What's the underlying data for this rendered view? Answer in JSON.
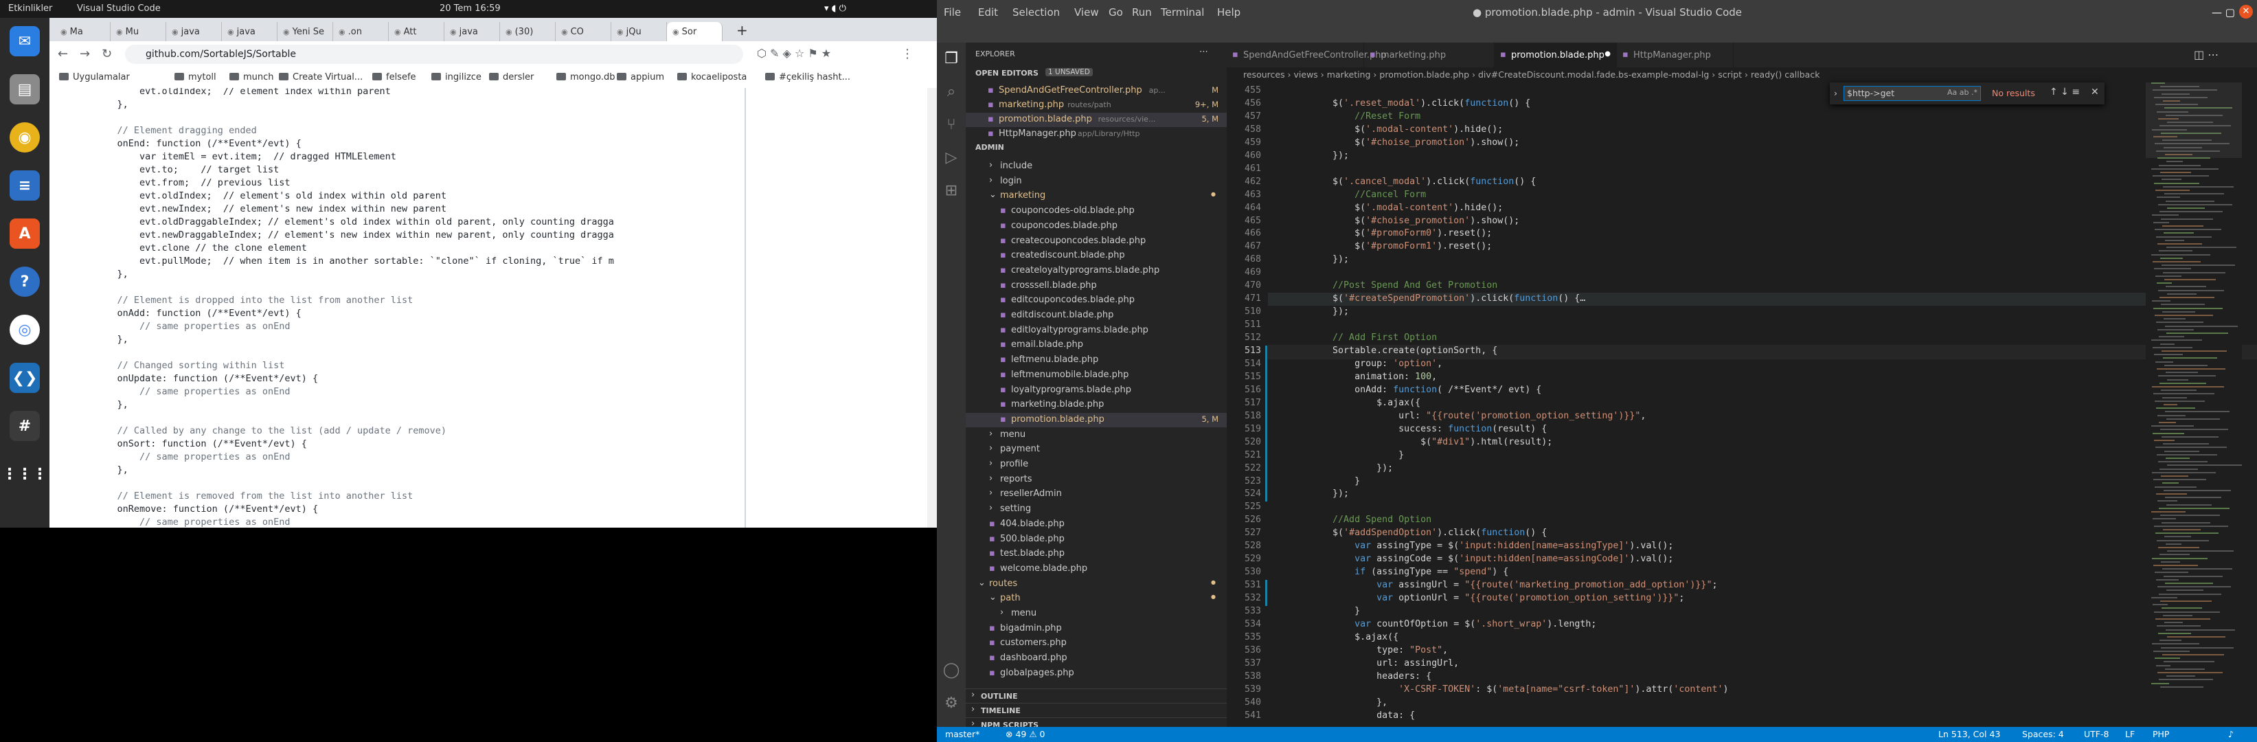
{
  "system": {
    "activities": "Etkinlikler",
    "app_menu": "Visual Studio Code",
    "clock": "20 Tem  16:59"
  },
  "browser": {
    "tabs": [
      "Ma",
      "Mu",
      "java",
      "java",
      "Yeni Se",
      ".on",
      "Att",
      "java",
      "(30)",
      "CO",
      "jQu",
      "Sor"
    ],
    "url": "github.com/SortableJS/Sortable",
    "bookmarks": [
      "Uygulamalar",
      "mytoll",
      "munch",
      "Create Virtual...",
      "felsefe",
      "ingilizce",
      "dersler",
      "mongo.db",
      "appium",
      "kocaeliposta",
      "#çekiliş hasht..."
    ],
    "code_lines": [
      "        evt.oldIndex;  // element index within parent",
      "    },",
      "",
      "    // Element dragging ended",
      "    onEnd: function (/**Event*/evt) {",
      "        var itemEl = evt.item;  // dragged HTMLElement",
      "        evt.to;    // target list",
      "        evt.from;  // previous list",
      "        evt.oldIndex;  // element's old index within old parent",
      "        evt.newIndex;  // element's new index within new parent",
      "        evt.oldDraggableIndex; // element's old index within old parent, only counting dragga",
      "        evt.newDraggableIndex; // element's new index within new parent, only counting dragga",
      "        evt.clone // the clone element",
      "        evt.pullMode;  // when item is in another sortable: `\"clone\"` if cloning, `true` if m",
      "    },",
      "",
      "    // Element is dropped into the list from another list",
      "    onAdd: function (/**Event*/evt) {",
      "        // same properties as onEnd",
      "    },",
      "",
      "    // Changed sorting within list",
      "    onUpdate: function (/**Event*/evt) {",
      "        // same properties as onEnd",
      "    },",
      "",
      "    // Called by any change to the list (add / update / remove)",
      "    onSort: function (/**Event*/evt) {",
      "        // same properties as onEnd",
      "    },",
      "",
      "    // Element is removed from the list into another list",
      "    onRemove: function (/**Event*/evt) {",
      "        // same properties as onEnd"
    ]
  },
  "vscode": {
    "title": "● promotion.blade.php - admin - Visual Studio Code",
    "menu": [
      "File",
      "Edit",
      "Selection",
      "View",
      "Go",
      "Run",
      "Terminal",
      "Help"
    ],
    "explorer_title": "EXPLORER",
    "open_editors_label": "OPEN EDITORS",
    "unsaved_badge": "1 UNSAVED",
    "open_editors": [
      {
        "name": "SpendAndGetFreeController.php",
        "path": "ap...",
        "flag": "M"
      },
      {
        "name": "marketing.php",
        "path": "routes/path",
        "flag": "9+, M"
      },
      {
        "name": "promotion.blade.php",
        "path": "resources/vie...",
        "flag": "5, M"
      },
      {
        "name": "HttpManager.php",
        "path": "app/Library/Http",
        "flag": ""
      }
    ],
    "workspace": "ADMIN",
    "tree": [
      {
        "label": "include",
        "indent": 1,
        "folder": true
      },
      {
        "label": "login",
        "indent": 1,
        "folder": true
      },
      {
        "label": "marketing",
        "indent": 1,
        "folder": true,
        "open": true,
        "mod": true
      },
      {
        "label": "couponcodes-old.blade.php",
        "indent": 2
      },
      {
        "label": "couponcodes.blade.php",
        "indent": 2
      },
      {
        "label": "createcouponcodes.blade.php",
        "indent": 2
      },
      {
        "label": "creatediscount.blade.php",
        "indent": 2
      },
      {
        "label": "createloyaltyprograms.blade.php",
        "indent": 2
      },
      {
        "label": "crosssell.blade.php",
        "indent": 2
      },
      {
        "label": "editcouponcodes.blade.php",
        "indent": 2
      },
      {
        "label": "editdiscount.blade.php",
        "indent": 2
      },
      {
        "label": "editloyaltyprograms.blade.php",
        "indent": 2
      },
      {
        "label": "email.blade.php",
        "indent": 2
      },
      {
        "label": "leftmenu.blade.php",
        "indent": 2
      },
      {
        "label": "leftmenumobile.blade.php",
        "indent": 2
      },
      {
        "label": "loyaltyprograms.blade.php",
        "indent": 2
      },
      {
        "label": "marketing.blade.php",
        "indent": 2
      },
      {
        "label": "promotion.blade.php",
        "indent": 2,
        "active": true,
        "flag": "5, M"
      },
      {
        "label": "menu",
        "indent": 1,
        "folder": true
      },
      {
        "label": "payment",
        "indent": 1,
        "folder": true
      },
      {
        "label": "profile",
        "indent": 1,
        "folder": true
      },
      {
        "label": "reports",
        "indent": 1,
        "folder": true
      },
      {
        "label": "resellerAdmin",
        "indent": 1,
        "folder": true
      },
      {
        "label": "setting",
        "indent": 1,
        "folder": true
      },
      {
        "label": "404.blade.php",
        "indent": 1
      },
      {
        "label": "500.blade.php",
        "indent": 1
      },
      {
        "label": "test.blade.php",
        "indent": 1
      },
      {
        "label": "welcome.blade.php",
        "indent": 1
      },
      {
        "label": "routes",
        "indent": 0,
        "folder": true,
        "open": true,
        "mod": true
      },
      {
        "label": "path",
        "indent": 1,
        "folder": true,
        "open": true,
        "mod": true
      },
      {
        "label": "menu",
        "indent": 2,
        "folder": true
      },
      {
        "label": "bigadmin.php",
        "indent": 1
      },
      {
        "label": "customers.php",
        "indent": 1
      },
      {
        "label": "dashboard.php",
        "indent": 1
      },
      {
        "label": "globalpages.php",
        "indent": 1
      }
    ],
    "panels": [
      "OUTLINE",
      "TIMELINE",
      "NPM SCRIPTS"
    ],
    "editor_tabs": [
      "SpendAndGetFreeController.php",
      "marketing.php",
      "promotion.blade.php",
      "HttpManager.php"
    ],
    "breadcrumbs": "resources › views › marketing › promotion.blade.php › div#CreateDiscount.modal.fade.bs-example-modal-lg › script › ready() callback",
    "find": {
      "value": "$http->get",
      "result": "No results"
    },
    "code": [
      {
        "n": "455",
        "t": ""
      },
      {
        "n": "456",
        "t": "        $('.reset_modal').click(function() {"
      },
      {
        "n": "457",
        "t": "            //Reset Form"
      },
      {
        "n": "458",
        "t": "            $('.modal-content').hide();"
      },
      {
        "n": "459",
        "t": "            $('#choise_promotion').show();"
      },
      {
        "n": "460",
        "t": "        });"
      },
      {
        "n": "461",
        "t": ""
      },
      {
        "n": "462",
        "t": "        $('.cancel_modal').click(function() {"
      },
      {
        "n": "463",
        "t": "            //Cancel Form"
      },
      {
        "n": "464",
        "t": "            $('.modal-content').hide();"
      },
      {
        "n": "465",
        "t": "            $('#choise_promotion').show();"
      },
      {
        "n": "466",
        "t": "            $('#promoForm0').reset();"
      },
      {
        "n": "467",
        "t": "            $('#promoForm1').reset();"
      },
      {
        "n": "468",
        "t": "        });"
      },
      {
        "n": "469",
        "t": ""
      },
      {
        "n": "470",
        "t": "        //Post Spend And Get Promotion"
      },
      {
        "n": "471",
        "t": "        $('#createSpendPromotion').click(function() {…"
      },
      {
        "n": "510",
        "t": "        });"
      },
      {
        "n": "511",
        "t": ""
      },
      {
        "n": "512",
        "t": "        // Add First Option"
      },
      {
        "n": "513",
        "t": "        Sortable.create(optionSorth, {"
      },
      {
        "n": "514",
        "t": "            group: 'option',"
      },
      {
        "n": "515",
        "t": "            animation: 100,"
      },
      {
        "n": "516",
        "t": "            onAdd: function( /**Event*/ evt) {"
      },
      {
        "n": "517",
        "t": "                $.ajax({"
      },
      {
        "n": "518",
        "t": "                    url: \"{{route('promotion_option_setting')}}\","
      },
      {
        "n": "519",
        "t": "                    success: function(result) {"
      },
      {
        "n": "520",
        "t": "                        $(\"#div1\").html(result);"
      },
      {
        "n": "521",
        "t": "                    }"
      },
      {
        "n": "522",
        "t": "                });"
      },
      {
        "n": "523",
        "t": "            }"
      },
      {
        "n": "524",
        "t": "        });"
      },
      {
        "n": "525",
        "t": ""
      },
      {
        "n": "526",
        "t": "        //Add Spend Option"
      },
      {
        "n": "527",
        "t": "        $('#addSpendOption').click(function() {"
      },
      {
        "n": "528",
        "t": "            var assingType = $('input:hidden[name=assingType]').val();"
      },
      {
        "n": "529",
        "t": "            var assingCode = $('input:hidden[name=assingCode]').val();"
      },
      {
        "n": "530",
        "t": "            if (assingType == \"spend\") {"
      },
      {
        "n": "531",
        "t": "                var assingUrl = \"{{route('marketing_promotion_add_option')}}\";"
      },
      {
        "n": "532",
        "t": "                var optionUrl = \"{{route('promotion_option_setting')}}\";"
      },
      {
        "n": "533",
        "t": "            }"
      },
      {
        "n": "534",
        "t": "            var countOfOption = $('.short_wrap').length;"
      },
      {
        "n": "535",
        "t": "            $.ajax({"
      },
      {
        "n": "536",
        "t": "                type: \"Post\","
      },
      {
        "n": "537",
        "t": "                url: assingUrl,"
      },
      {
        "n": "538",
        "t": "                headers: {"
      },
      {
        "n": "539",
        "t": "                    'X-CSRF-TOKEN': $('meta[name=\"csrf-token\"]').attr('content')"
      },
      {
        "n": "540",
        "t": "                },"
      },
      {
        "n": "541",
        "t": "                data: {"
      }
    ],
    "status": {
      "branch": "master*",
      "problems": "⊗ 49 ⚠ 0",
      "position": "Ln 513, Col 43",
      "spaces": "Spaces: 4",
      "encoding": "UTF-8",
      "eol": "LF",
      "lang": "PHP"
    }
  }
}
